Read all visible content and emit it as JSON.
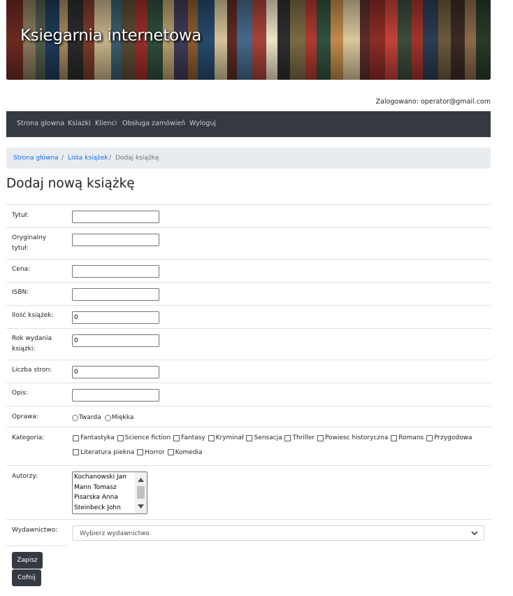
{
  "banner": {
    "title": "Ksiegarnia internetowa"
  },
  "user": {
    "logged_in_text": "Zalogowano: operator@gmail.com"
  },
  "nav": {
    "items": [
      {
        "label": "Strona glowna"
      },
      {
        "label": "Ksiazki"
      },
      {
        "label": "Klienci"
      },
      {
        "label": "Obsługa zamówień"
      },
      {
        "label": "Wyloguj"
      }
    ]
  },
  "breadcrumb": {
    "home": "Strona główna",
    "list": "Lista książek",
    "current": "Dodaj książkę",
    "separator": "/"
  },
  "page": {
    "title": "Dodaj nową książkę"
  },
  "form": {
    "title_label": "Tytuł:",
    "title_value": "",
    "original_title_label_1": "Oryginalny",
    "original_title_label_2": "tytuł:",
    "original_title_value": "",
    "price_label": "Cena:",
    "price_value": "",
    "isbn_label": "ISBN:",
    "isbn_value": "",
    "quantity_label": "Ilość książek:",
    "quantity_value": "0",
    "year_label_1": "Rok wydania",
    "year_label_2": "książki:",
    "year_value": "0",
    "pages_label": "Liczba stron:",
    "pages_value": "0",
    "description_label": "Opis:",
    "description_value": "",
    "binding_label": "Oprawa:",
    "binding_options": [
      "Twarda",
      "Miękka"
    ],
    "category_label": "Kategoria:",
    "categories": [
      "Fantastyka",
      "Science fiction",
      "Fantasy",
      "Kryminał",
      "Sensacja",
      "Thriller",
      "Powiesc historyczna",
      "Romans",
      "Przygodowa",
      "Literatura piekna",
      "Horror",
      "Komedia"
    ],
    "authors_label": "Autorzy:",
    "authors": [
      "Kochanowski Jan",
      "Mann Tomasz",
      "Pisarska Anna",
      "Steinbeck John"
    ],
    "publisher_label": "Wydawnictwo:",
    "publisher_placeholder": "Wybierz wydawnictwo",
    "save_button": "Zapisz",
    "back_button": "Cofnij"
  },
  "colors": {
    "navbar_bg": "#343a40",
    "link": "#0d6efd",
    "breadcrumb_bg": "#e9ecef",
    "button_bg": "#343a40"
  }
}
